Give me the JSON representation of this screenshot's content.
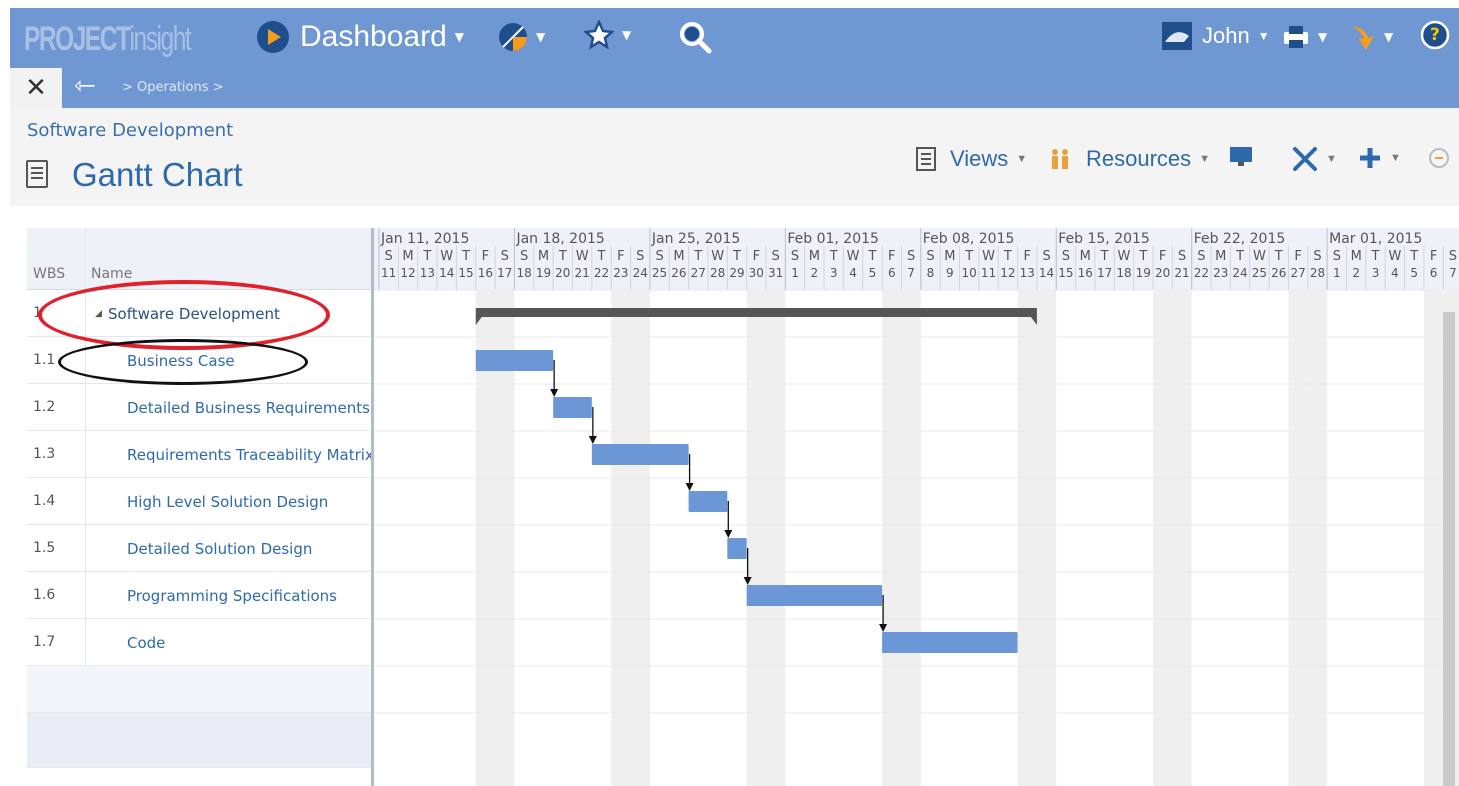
{
  "app": {
    "logo_project": "PROJECT",
    "logo_insight": "insight",
    "dashboard_label": "Dashboard",
    "user_name": "John",
    "help_glyph": "?"
  },
  "nav": {
    "close_glyph": "✕",
    "back_glyph": "⇽",
    "breadcrumb": "> Operations >"
  },
  "page": {
    "parent": "Software Development",
    "title": "Gantt Chart"
  },
  "toolbar": {
    "views_label": "Views",
    "resources_label": "Resources"
  },
  "grid": {
    "columns": [
      "WBS",
      "Name"
    ],
    "rows": [
      {
        "wbs": "1",
        "name": "Software Development",
        "summary": true,
        "toggle": "◢"
      },
      {
        "wbs": "1.1",
        "name": "Business Case"
      },
      {
        "wbs": "1.2",
        "name": "Detailed Business Requirements"
      },
      {
        "wbs": "1.3",
        "name": "Requirements Traceability Matrix"
      },
      {
        "wbs": "1.4",
        "name": "High Level Solution Design"
      },
      {
        "wbs": "1.5",
        "name": "Detailed Solution Design"
      },
      {
        "wbs": "1.6",
        "name": "Programming Specifications"
      },
      {
        "wbs": "1.7",
        "name": "Code"
      }
    ]
  },
  "timeline": {
    "weeks": [
      "Jan 11, 2015",
      "Jan 18, 2015",
      "Jan 25, 2015",
      "Feb 01, 2015",
      "Feb 08, 2015",
      "Feb 15, 2015",
      "Feb 22, 2015",
      "Mar 01, 2015"
    ],
    "day_letters": [
      "S",
      "M",
      "T",
      "W",
      "T",
      "F",
      "S"
    ],
    "day_numbers": [
      "11",
      "12",
      "13",
      "14",
      "15",
      "16",
      "17",
      "18",
      "19",
      "20",
      "21",
      "22",
      "23",
      "24",
      "25",
      "26",
      "27",
      "28",
      "29",
      "30",
      "31",
      "1",
      "2",
      "3",
      "4",
      "5",
      "6",
      "7",
      "8",
      "9",
      "10",
      "11",
      "12",
      "13",
      "14",
      "15",
      "16",
      "17",
      "18",
      "19",
      "20",
      "21",
      "22",
      "23",
      "24",
      "25",
      "26",
      "27",
      "28",
      "1",
      "2",
      "3",
      "4",
      "5",
      "6",
      "7"
    ],
    "summary": {
      "start": "2015-01-16",
      "end": "2015-02-13"
    },
    "tasks": [
      {
        "start": "2015-01-16",
        "end": "2015-01-19"
      },
      {
        "start": "2015-01-20",
        "end": "2015-01-21"
      },
      {
        "start": "2015-01-22",
        "end": "2015-01-26"
      },
      {
        "start": "2015-01-27",
        "end": "2015-01-28"
      },
      {
        "start": "2015-01-29",
        "end": "2015-01-29"
      },
      {
        "start": "2015-01-30",
        "end": "2015-02-05"
      },
      {
        "start": "2015-02-06",
        "end": "2015-02-12"
      }
    ]
  },
  "colors": {
    "topbar": "#6f97d2",
    "bar": "#6b97d6",
    "summary_bar": "#555555",
    "weekend": "#efefef",
    "highlight_red": "#e0202a"
  }
}
